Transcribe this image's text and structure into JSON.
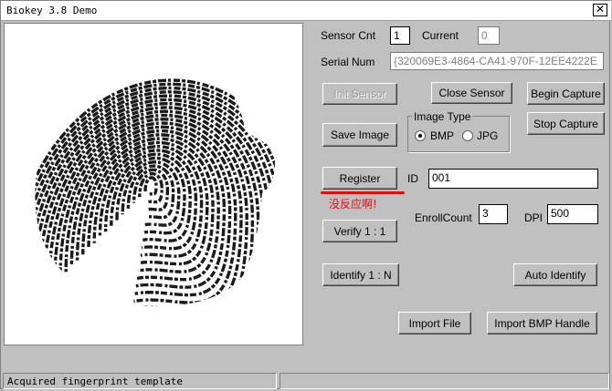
{
  "window": {
    "title": "Biokey 3.8 Demo",
    "close_glyph": "✕"
  },
  "sensor": {
    "count_label": "Sensor Cnt",
    "count_value": "1",
    "current_label": "Current",
    "current_value": "0",
    "serial_label": "Serial Num",
    "serial_value": "{320069E3-4864-CA41-970F-12EE4222E"
  },
  "buttons": {
    "init_sensor": "Init Sensor",
    "close_sensor": "Close  Sensor",
    "begin_capture": "Begin Capture",
    "save_image": "Save Image",
    "stop_capture": "Stop Capture",
    "register": "Register",
    "verify": "Verify 1 : 1",
    "identify": "Identify 1 : N",
    "auto_identify": "Auto Identify",
    "import_file": "Import File",
    "import_bmp": "Import BMP Handle"
  },
  "image_type": {
    "title": "Image Type",
    "options": [
      {
        "label": "BMP",
        "checked": true
      },
      {
        "label": "JPG",
        "checked": false
      }
    ]
  },
  "id_field": {
    "label": "ID",
    "value": "001"
  },
  "enroll": {
    "label": "EnrollCount",
    "value": "3"
  },
  "dpi": {
    "label": "DPI",
    "value": "500"
  },
  "annotation": {
    "text": "没反应啊!",
    "color": "#e01010"
  },
  "status": {
    "pane1": "Acquired fingerprint template",
    "pane2": ""
  }
}
